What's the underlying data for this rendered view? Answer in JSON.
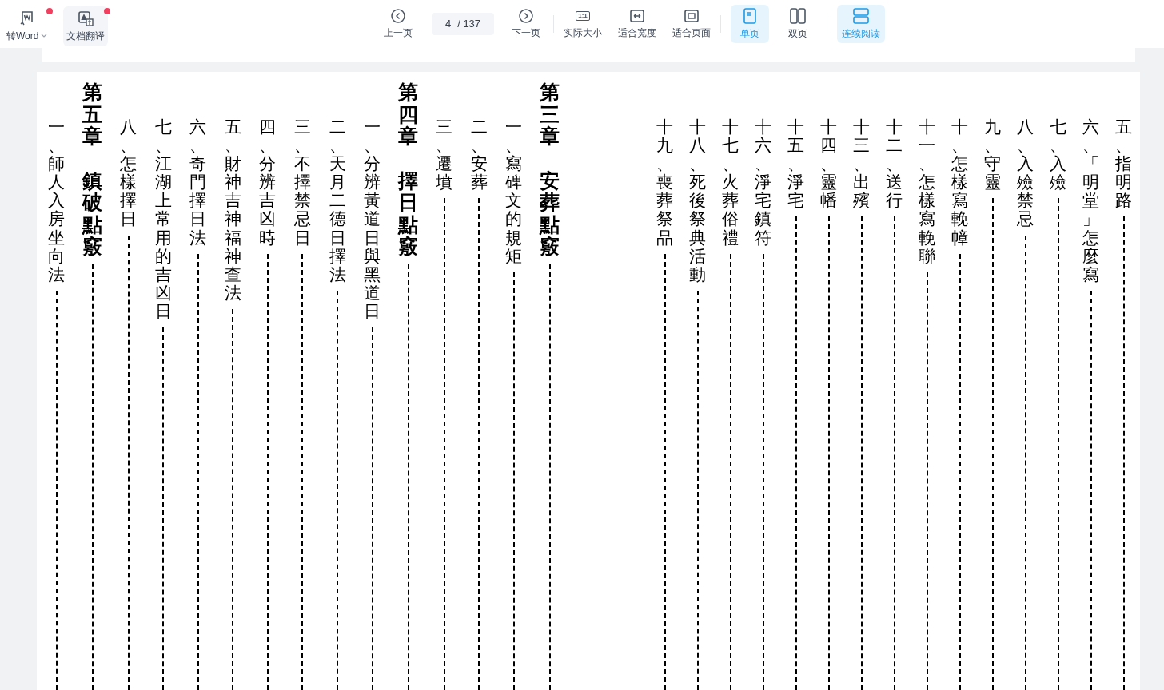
{
  "toolbar": {
    "left_tools": [
      {
        "kind": "word",
        "label": "转Word",
        "notification": true,
        "selected": false
      },
      {
        "kind": "translate",
        "label": "文档翻译",
        "notification": true,
        "selected": true
      }
    ],
    "prev": {
      "label": "上一页"
    },
    "page": {
      "value": "4",
      "total": "/ 137"
    },
    "next": {
      "label": "下一页"
    },
    "zoom_tools": [
      {
        "kind": "actual",
        "icon_text": "1:1",
        "label": "实际大小"
      },
      {
        "kind": "width",
        "label": "适合宽度"
      },
      {
        "kind": "page",
        "label": "适合页面"
      }
    ],
    "view_modes": [
      {
        "kind": "single",
        "label": "单页",
        "selected": true
      },
      {
        "kind": "double",
        "label": "双页",
        "selected": false
      }
    ],
    "continuous": {
      "label": "连续阅读",
      "selected": true
    }
  },
  "document": {
    "blocks": [
      {
        "columns": [
          {
            "kind": "item",
            "text": "一、師人入房坐向法"
          },
          {
            "kind": "chapter",
            "number": "第五章",
            "title": "鎮破點竅"
          },
          {
            "kind": "item",
            "text": "八、怎樣擇日"
          },
          {
            "kind": "item",
            "text": "七、江湖上常用的吉凶日"
          },
          {
            "kind": "item",
            "text": "六、奇門擇日法"
          },
          {
            "kind": "item",
            "text": "五、財神吉神福神查法"
          },
          {
            "kind": "item",
            "text": "四、分辨吉凶時"
          },
          {
            "kind": "item",
            "text": "三、不擇禁忌日"
          },
          {
            "kind": "item",
            "text": "二、天月二德日擇法"
          },
          {
            "kind": "item",
            "text": "一、分辨黃道日與黑道日"
          },
          {
            "kind": "chapter",
            "number": "第四章",
            "title": "擇日點竅"
          },
          {
            "kind": "item",
            "text": "三、遷墳"
          },
          {
            "kind": "item",
            "text": "二、安葬"
          },
          {
            "kind": "item",
            "text": "一、寫碑文的規矩"
          },
          {
            "kind": "chapter",
            "number": "第三章",
            "title": "安葬點竅"
          }
        ]
      },
      {
        "columns": [
          {
            "kind": "item",
            "text": "十九、喪葬祭品"
          },
          {
            "kind": "item",
            "text": "十八、死後祭典活動"
          },
          {
            "kind": "item",
            "text": "十七、火葬俗禮"
          },
          {
            "kind": "item",
            "text": "十六、淨宅鎮符"
          },
          {
            "kind": "item",
            "text": "十五、淨宅"
          },
          {
            "kind": "item",
            "text": "十四、靈幡"
          },
          {
            "kind": "item",
            "text": "十三、出殯"
          },
          {
            "kind": "item",
            "text": "十二、送行"
          },
          {
            "kind": "item",
            "text": "十一、怎樣寫輓聯"
          },
          {
            "kind": "item",
            "text": "十、怎樣寫輓幛"
          },
          {
            "kind": "item",
            "text": "九、守靈"
          },
          {
            "kind": "item",
            "text": "八、入殮禁忌"
          },
          {
            "kind": "item",
            "text": "七、入殮"
          },
          {
            "kind": "item",
            "text": "六、「明堂」怎麼寫"
          },
          {
            "kind": "item",
            "text": "五、指明路"
          }
        ]
      }
    ]
  }
}
